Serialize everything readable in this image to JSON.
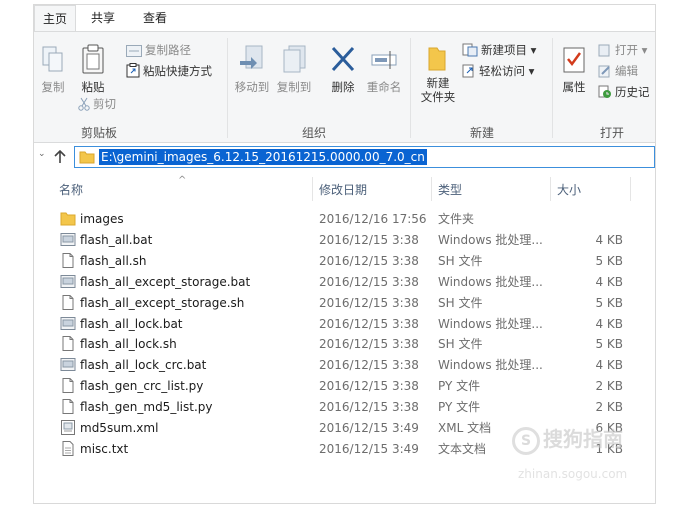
{
  "ribbon_tabs": [
    {
      "label": "主页"
    },
    {
      "label": "共享"
    },
    {
      "label": "查看"
    }
  ],
  "clipboard": {
    "copy": "复制",
    "paste": "粘贴",
    "copy_path": "复制路径",
    "paste_shortcut": "粘贴快捷方式",
    "cut": "剪切",
    "group": "剪贴板"
  },
  "organize": {
    "move_to": "移动到",
    "copy_to": "复制到",
    "delete": "删除",
    "rename": "重命名",
    "group": "组织"
  },
  "new": {
    "new_folder_line1": "新建",
    "new_folder_line2": "文件夹",
    "new_item": "新建项目",
    "easy_access": "轻松访问",
    "group": "新建"
  },
  "open": {
    "properties": "属性",
    "open": "打开",
    "edit": "编辑",
    "history": "历史记",
    "group": "打开"
  },
  "address": {
    "path": "E:\\gemini_images_6.12.15_20161215.0000.00_7.0_cn"
  },
  "columns": {
    "name": "名称",
    "date": "修改日期",
    "type": "类型",
    "size": "大小"
  },
  "files": [
    {
      "name": "images",
      "date": "2016/12/16 17:56",
      "type": "文件夹",
      "size": "",
      "icon": "folder-icon"
    },
    {
      "name": "flash_all.bat",
      "date": "2016/12/15 3:38",
      "type": "Windows 批处理...",
      "size": "4 KB",
      "icon": "batch-file-icon"
    },
    {
      "name": "flash_all.sh",
      "date": "2016/12/15 3:38",
      "type": "SH 文件",
      "size": "5 KB",
      "icon": "file-icon"
    },
    {
      "name": "flash_all_except_storage.bat",
      "date": "2016/12/15 3:38",
      "type": "Windows 批处理...",
      "size": "4 KB",
      "icon": "batch-file-icon"
    },
    {
      "name": "flash_all_except_storage.sh",
      "date": "2016/12/15 3:38",
      "type": "SH 文件",
      "size": "5 KB",
      "icon": "file-icon"
    },
    {
      "name": "flash_all_lock.bat",
      "date": "2016/12/15 3:38",
      "type": "Windows 批处理...",
      "size": "4 KB",
      "icon": "batch-file-icon"
    },
    {
      "name": "flash_all_lock.sh",
      "date": "2016/12/15 3:38",
      "type": "SH 文件",
      "size": "5 KB",
      "icon": "file-icon"
    },
    {
      "name": "flash_all_lock_crc.bat",
      "date": "2016/12/15 3:38",
      "type": "Windows 批处理...",
      "size": "4 KB",
      "icon": "batch-file-icon"
    },
    {
      "name": "flash_gen_crc_list.py",
      "date": "2016/12/15 3:38",
      "type": "PY 文件",
      "size": "2 KB",
      "icon": "file-icon"
    },
    {
      "name": "flash_gen_md5_list.py",
      "date": "2016/12/15 3:38",
      "type": "PY 文件",
      "size": "2 KB",
      "icon": "file-icon"
    },
    {
      "name": "md5sum.xml",
      "date": "2016/12/15 3:49",
      "type": "XML 文档",
      "size": "6 KB",
      "icon": "xml-file-icon"
    },
    {
      "name": "misc.txt",
      "date": "2016/12/15 3:49",
      "type": "文本文档",
      "size": "1 KB",
      "icon": "text-file-icon"
    }
  ],
  "watermark": {
    "text": "搜狗指南",
    "sub": "zhinan.sogou.com"
  }
}
